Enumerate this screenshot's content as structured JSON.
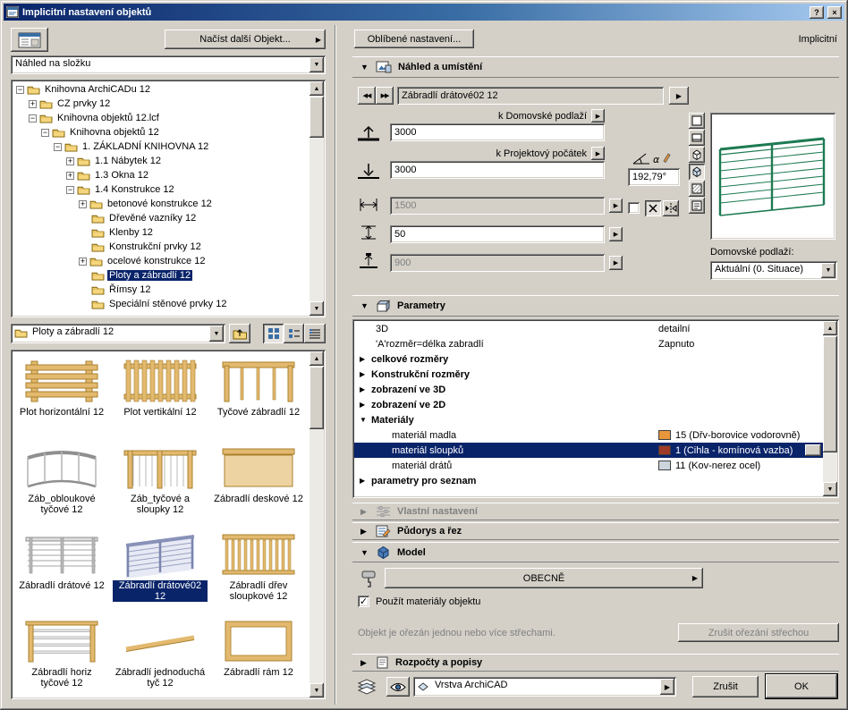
{
  "window": {
    "title": "Implicitní nastavení objektů",
    "help_glyph": "?",
    "close_glyph": "×",
    "mode_label": "Implicitní"
  },
  "colors": {
    "selection": "#0a246a",
    "chrome": "#d4d0c8",
    "preview_line": "#1d7a52",
    "thumb_tan": "#e2b96e"
  },
  "icons": {
    "window-icon": "blue dialog glyph",
    "default-settings-icon": "dialog with grid",
    "folder-icon": "yellow folder",
    "folder-up-icon": "folder with up arrow",
    "dropdown-arrow-icon": "▼",
    "menu-arrow-icon": "▶",
    "prev-glyph": "◀◀",
    "next-glyph": "▶▶",
    "check-glyph": "✓",
    "eye-icon": "eye",
    "layer-stack-icon": "stacked sheets"
  },
  "left_panel": {
    "load_object_button": "Načíst další Objekt...",
    "folder_view_select": {
      "value": "Náhled na složku"
    },
    "tree": [
      {
        "depth": 0,
        "expander": "-",
        "label": "Knihovna ArchiCADu 12"
      },
      {
        "depth": 1,
        "expander": "+",
        "label": "CZ prvky 12"
      },
      {
        "depth": 1,
        "expander": "-",
        "label": "Knihovna objektů 12.lcf"
      },
      {
        "depth": 2,
        "expander": "-",
        "label": "Knihovna objektů 12"
      },
      {
        "depth": 3,
        "expander": "-",
        "label": "1. ZÁKLADNÍ KNIHOVNA 12"
      },
      {
        "depth": 4,
        "expander": "+",
        "label": "1.1 Nábytek 12"
      },
      {
        "depth": 4,
        "expander": "+",
        "label": "1.3 Okna 12"
      },
      {
        "depth": 4,
        "expander": "-",
        "label": "1.4 Konstrukce 12"
      },
      {
        "depth": 5,
        "expander": "+",
        "label": "betonové konstrukce 12"
      },
      {
        "depth": 5,
        "expander": "",
        "label": "Dřevěné vazníky 12"
      },
      {
        "depth": 5,
        "expander": "",
        "label": "Klenby 12"
      },
      {
        "depth": 5,
        "expander": "",
        "label": "Konstrukční prvky 12"
      },
      {
        "depth": 5,
        "expander": "+",
        "label": "ocelové konstrukce 12"
      },
      {
        "depth": 5,
        "expander": "",
        "label": "Ploty a zábradlí 12",
        "selected": true
      },
      {
        "depth": 5,
        "expander": "",
        "label": "Římsy 12"
      },
      {
        "depth": 5,
        "expander": "",
        "label": "Speciální stěnové prvky 12"
      }
    ],
    "current_folder_select": {
      "value": "Ploty a zábradlí 12"
    },
    "items": [
      {
        "label": "Plot horizontální 12",
        "thumb": "fence_h"
      },
      {
        "label": "Plot vertikální 12",
        "thumb": "fence_v"
      },
      {
        "label": "Tyčové zábradlí 12",
        "thumb": "rod_rail"
      },
      {
        "label": "Záb_obloukové tyčové 12",
        "thumb": "curved_rail"
      },
      {
        "label": "Záb_tyčové a sloupky 12",
        "thumb": "rod_post_rail"
      },
      {
        "label": "Zábradlí deskové 12",
        "thumb": "panel_rail"
      },
      {
        "label": "Zábradlí drátové 12",
        "thumb": "wire_rail"
      },
      {
        "label": "Zábradlí drátové02 12",
        "thumb": "wire_rail2",
        "selected": true
      },
      {
        "label": "Zábradlí dřev sloupkové 12",
        "thumb": "spindle_rail"
      },
      {
        "label": "Zábradlí horiz tyčové 12",
        "thumb": "horiz_rod_rail"
      },
      {
        "label": "Zábradlí jednoduchá tyč 12",
        "thumb": "single_rod"
      },
      {
        "label": "Zábradlí rám 12",
        "thumb": "frame_rail"
      }
    ]
  },
  "right_panel": {
    "favorites_button": "Oblíbené nastavení...",
    "preview_section": {
      "title": "Náhled a umístění",
      "object_name": "Zábradlí drátové02 12",
      "anchor_story_label": "k Domovské podlaží",
      "story_elevation": "3000",
      "anchor_origin_label": "k Projektový počátek",
      "origin_elevation": "3000",
      "dim_a": "1500",
      "dim_b": "50",
      "dim_c": "900",
      "angle": "192,79°",
      "home_story_label": "Domovské podlaží:",
      "home_story_select": {
        "value": "Aktuální (0. Situace)"
      }
    },
    "parameters_section": {
      "title": "Parametry",
      "rows": [
        {
          "indent": 1,
          "arrow": "",
          "label": "3D",
          "value": "detailní"
        },
        {
          "indent": 1,
          "arrow": "",
          "label": "'A'rozměr=délka zabradlí",
          "value": "Zapnuto"
        },
        {
          "indent": 0,
          "arrow": "right",
          "label": "celkové rozměry",
          "bold": true
        },
        {
          "indent": 0,
          "arrow": "right",
          "label": "Konstrukční rozměry",
          "bold": true
        },
        {
          "indent": 0,
          "arrow": "right",
          "label": "zobrazení ve 3D",
          "bold": true
        },
        {
          "indent": 0,
          "arrow": "right",
          "label": "zobrazení ve 2D",
          "bold": true
        },
        {
          "indent": 0,
          "arrow": "down",
          "label": "Materiály",
          "bold": true
        },
        {
          "indent": 2,
          "arrow": "",
          "label": "materiál madla",
          "swatch": "#e8963c",
          "value": "15 (Dřv-borovice vodorovně)"
        },
        {
          "indent": 2,
          "arrow": "",
          "label": "materiál sloupků",
          "swatch": "#9e3b28",
          "value": "1 (Cihla - komínová vazba)",
          "selected": true
        },
        {
          "indent": 2,
          "arrow": "",
          "label": "materiál drátů",
          "swatch": "#ccd4dc",
          "value": "11 (Kov-nerez ocel)"
        },
        {
          "indent": 0,
          "arrow": "right",
          "label": "parametry pro seznam",
          "bold": true
        }
      ]
    },
    "custom_section_title": "Vlastní nastavení",
    "plan_section_title": "Půdorys a řez",
    "model_section": {
      "title": "Model",
      "general_button": "OBECNĚ",
      "use_object_materials_label": "Použít materiály objektu",
      "use_object_materials_checked": true,
      "trim_info_text": "Objekt je ořezán jednou nebo více střechami.",
      "trim_button": "Zrušit ořezání střechou"
    },
    "listing_section_title": "Rozpočty a popisy",
    "footer": {
      "layer_select": {
        "value": "Vrstva ArchiCAD"
      },
      "cancel_button": "Zrušit",
      "ok_button": "OK"
    }
  }
}
